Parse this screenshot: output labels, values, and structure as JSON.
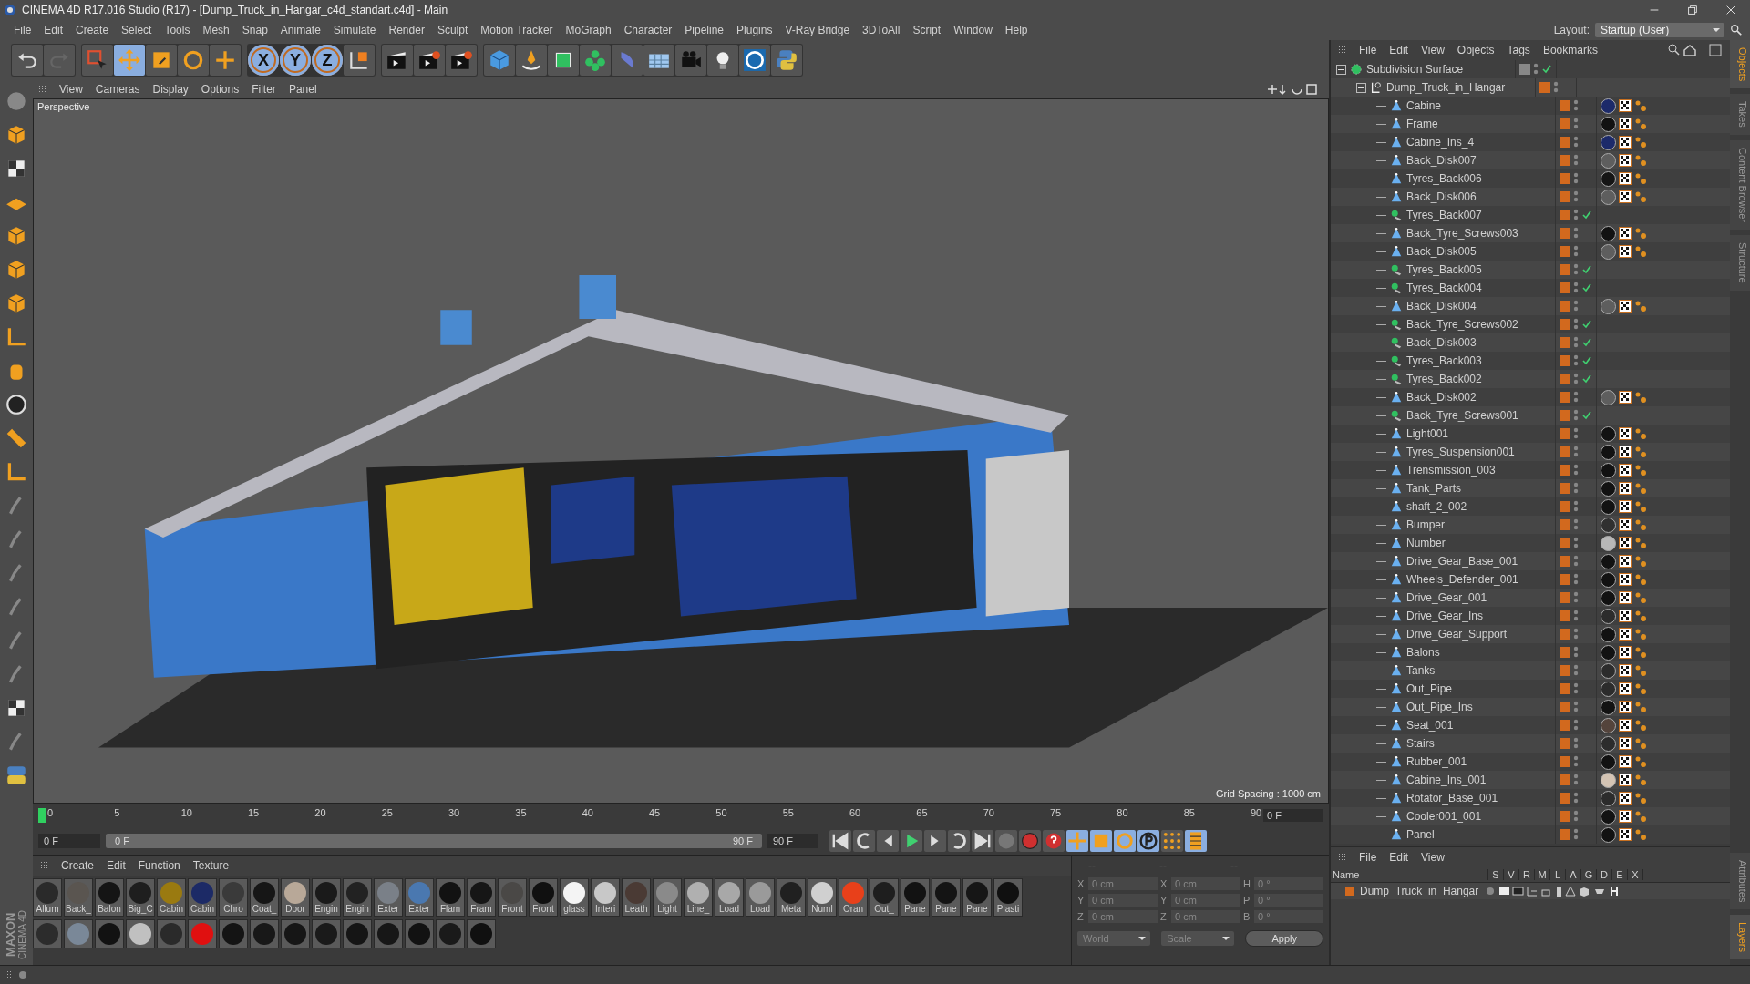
{
  "window": {
    "title": "CINEMA 4D R17.016 Studio (R17) - [Dump_Truck_in_Hangar_c4d_standart.c4d] - Main"
  },
  "menu": [
    "File",
    "Edit",
    "Create",
    "Select",
    "Tools",
    "Mesh",
    "Snap",
    "Animate",
    "Simulate",
    "Render",
    "Sculpt",
    "Motion Tracker",
    "MoGraph",
    "Character",
    "Pipeline",
    "Plugins",
    "V-Ray Bridge",
    "3DToAll",
    "Script",
    "Window",
    "Help"
  ],
  "layout": {
    "label": "Layout:",
    "value": "Startup (User)"
  },
  "toolbar": {
    "move_selected": true,
    "axis_buttons": [
      {
        "label": "X",
        "selected": true
      },
      {
        "label": "Y",
        "selected": true
      },
      {
        "label": "Z",
        "selected": true
      }
    ]
  },
  "left_toolbar": {
    "logo": [
      "MAXON",
      "CINEMA 4D"
    ]
  },
  "viewport": {
    "menu": [
      "View",
      "Cameras",
      "Display",
      "Options",
      "Filter",
      "Panel"
    ],
    "camera": "Perspective",
    "grid_spacing": "Grid Spacing : 1000 cm"
  },
  "timeline": {
    "ticks": [
      "0",
      "5",
      "10",
      "15",
      "20",
      "25",
      "30",
      "35",
      "40",
      "45",
      "50",
      "55",
      "60",
      "65",
      "70",
      "75",
      "80",
      "85",
      "90"
    ],
    "current_frame": "0 F",
    "start_field": "0 F",
    "range": {
      "level": 1,
      "start": "0 F",
      "end": "90 F"
    },
    "end_field": "90 F"
  },
  "material_manager": {
    "menu": [
      "Create",
      "Edit",
      "Function",
      "Texture"
    ],
    "materials": [
      {
        "label": "Allum",
        "color": "#2a2a2a"
      },
      {
        "label": "Back_",
        "color": "#5a5550"
      },
      {
        "label": "Balon",
        "color": "#151515"
      },
      {
        "label": "Big_C",
        "color": "#1e1e1e"
      },
      {
        "label": "Cabin",
        "color": "#9a7a10"
      },
      {
        "label": "Cabin",
        "color": "#1c2a66"
      },
      {
        "label": "Chro",
        "color": "#3a3a3a"
      },
      {
        "label": "Coat_",
        "color": "#161616"
      },
      {
        "label": "Door",
        "color": "#b8a898"
      },
      {
        "label": "Engin",
        "color": "#1a1a1a"
      },
      {
        "label": "Engin",
        "color": "#222222"
      },
      {
        "label": "Exter",
        "color": "#7a8088"
      },
      {
        "label": "Exter",
        "color": "#4a78b0"
      },
      {
        "label": "Flam",
        "color": "#121212"
      },
      {
        "label": "Fram",
        "color": "#161616"
      },
      {
        "label": "Front",
        "color": "#4a4846"
      },
      {
        "label": "Front",
        "color": "#101010"
      },
      {
        "label": "glass",
        "color": "#f4f4f4"
      },
      {
        "label": "Interi",
        "color": "#c8c8c8"
      },
      {
        "label": "Leath",
        "color": "#4a3a34"
      },
      {
        "label": "Light",
        "color": "#8a8a8a"
      },
      {
        "label": "Line_",
        "color": "#b0b0b0"
      },
      {
        "label": "Load",
        "color": "#a8a8a8"
      },
      {
        "label": "Load",
        "color": "#9a9a9a"
      },
      {
        "label": "Meta",
        "color": "#202020"
      },
      {
        "label": "Numl",
        "color": "#d0d0d0"
      },
      {
        "label": "Oran",
        "color": "#e8401a"
      },
      {
        "label": "Out_",
        "color": "#1e1e1e"
      },
      {
        "label": "Pane",
        "color": "#121212"
      },
      {
        "label": "Pane",
        "color": "#141414"
      },
      {
        "label": "Pane",
        "color": "#161616"
      },
      {
        "label": "Plasti",
        "color": "#101010"
      }
    ],
    "materials_row_2": [
      {
        "color": "#2c2c2c"
      },
      {
        "color": "#7a8898"
      },
      {
        "color": "#121212"
      },
      {
        "color": "#c0c0c0"
      },
      {
        "color": "#2a2a2a"
      },
      {
        "color": "#e01010"
      },
      {
        "color": "#141414"
      },
      {
        "color": "#181818"
      },
      {
        "color": "#161616"
      },
      {
        "color": "#1a1a1a"
      },
      {
        "color": "#151515"
      },
      {
        "color": "#171717"
      },
      {
        "color": "#121212"
      },
      {
        "color": "#1a1a1a"
      },
      {
        "color": "#101010"
      }
    ]
  },
  "coordinates": {
    "headers": [
      "--",
      "--",
      "--"
    ],
    "rows": [
      {
        "axis": "X",
        "position": "0 cm",
        "axis_2": "X",
        "size": "0 cm",
        "rot_axis": "H",
        "rotation": "0 °"
      },
      {
        "axis": "Y",
        "position": "0 cm",
        "axis_2": "Y",
        "size": "0 cm",
        "rot_axis": "P",
        "rotation": "0 °"
      },
      {
        "axis": "Z",
        "position": "0 cm",
        "axis_2": "Z",
        "size": "0 cm",
        "rot_axis": "B",
        "rotation": "0 °"
      }
    ],
    "space": "World",
    "mode": "Scale",
    "apply": "Apply"
  },
  "object_manager": {
    "menu": [
      "File",
      "Edit",
      "View",
      "Objects",
      "Tags",
      "Bookmarks"
    ],
    "objects": [
      {
        "name": "Subdivision Surface",
        "kind": "subdivision",
        "checked": true,
        "expanded": true,
        "children": [
          {
            "name": "Dump_Truck_in_Hangar",
            "kind": "null",
            "checked": false,
            "expanded": true,
            "children": [
              {
                "name": "Cabine",
                "kind": "polygon",
                "checked": false,
                "color": "#1c2a6a"
              },
              {
                "name": "Frame",
                "kind": "polygon",
                "checked": false,
                "color": "#121212"
              },
              {
                "name": "Cabine_Ins_4",
                "kind": "polygon",
                "checked": false,
                "color": "#1c2a6a"
              },
              {
                "name": "Back_Disk007",
                "kind": "polygon",
                "checked": false,
                "color": "#5e5e5e"
              },
              {
                "name": "Tyres_Back006",
                "kind": "polygon",
                "checked": false,
                "color": "#151515"
              },
              {
                "name": "Back_Disk006",
                "kind": "polygon",
                "checked": false,
                "color": "#5e5e5e"
              },
              {
                "name": "Tyres_Back007",
                "kind": "instance",
                "checked": true
              },
              {
                "name": "Back_Tyre_Screws003",
                "kind": "polygon",
                "checked": false,
                "color": "#121212"
              },
              {
                "name": "Back_Disk005",
                "kind": "polygon",
                "checked": false,
                "color": "#5e5e5e"
              },
              {
                "name": "Tyres_Back005",
                "kind": "instance",
                "checked": true
              },
              {
                "name": "Tyres_Back004",
                "kind": "instance",
                "checked": true
              },
              {
                "name": "Back_Disk004",
                "kind": "polygon",
                "checked": false,
                "color": "#5e5e5e"
              },
              {
                "name": "Back_Tyre_Screws002",
                "kind": "instance",
                "checked": true
              },
              {
                "name": "Back_Disk003",
                "kind": "instance",
                "checked": true
              },
              {
                "name": "Tyres_Back003",
                "kind": "instance",
                "checked": true
              },
              {
                "name": "Tyres_Back002",
                "kind": "instance",
                "checked": true
              },
              {
                "name": "Back_Disk002",
                "kind": "polygon",
                "checked": false,
                "color": "#5e5e5e"
              },
              {
                "name": "Back_Tyre_Screws001",
                "kind": "instance",
                "checked": true
              },
              {
                "name": "Light001",
                "kind": "polygon",
                "checked": false,
                "color": "#121212"
              },
              {
                "name": "Tyres_Suspension001",
                "kind": "polygon",
                "checked": false,
                "color": "#121212"
              },
              {
                "name": "Trensmission_003",
                "kind": "polygon",
                "checked": false,
                "color": "#121212"
              },
              {
                "name": "Tank_Parts",
                "kind": "polygon",
                "checked": false,
                "color": "#121212"
              },
              {
                "name": "shaft_2_002",
                "kind": "polygon",
                "checked": false,
                "color": "#121212"
              },
              {
                "name": "Bumper",
                "kind": "polygon",
                "checked": false,
                "color": "#303030"
              },
              {
                "name": "Number",
                "kind": "polygon",
                "checked": false,
                "color": "#b8b8b8"
              },
              {
                "name": "Drive_Gear_Base_001",
                "kind": "polygon",
                "checked": false,
                "color": "#121212"
              },
              {
                "name": "Wheels_Defender_001",
                "kind": "polygon",
                "checked": false,
                "color": "#121212"
              },
              {
                "name": "Drive_Gear_001",
                "kind": "polygon",
                "checked": false,
                "color": "#121212"
              },
              {
                "name": "Drive_Gear_Ins",
                "kind": "polygon",
                "checked": false,
                "color": "#2c2c2c"
              },
              {
                "name": "Drive_Gear_Support",
                "kind": "polygon",
                "checked": false,
                "color": "#121212"
              },
              {
                "name": "Balons",
                "kind": "polygon",
                "checked": false,
                "color": "#121212"
              },
              {
                "name": "Tanks",
                "kind": "polygon",
                "checked": false,
                "color": "#2c2c2c"
              },
              {
                "name": "Out_Pipe",
                "kind": "polygon",
                "checked": false,
                "color": "#2c2c2c"
              },
              {
                "name": "Out_Pipe_Ins",
                "kind": "polygon",
                "checked": false,
                "color": "#121212"
              },
              {
                "name": "Seat_001",
                "kind": "polygon",
                "checked": false,
                "color": "#54443c"
              },
              {
                "name": "Stairs",
                "kind": "polygon",
                "checked": false,
                "color": "#2c2c2c"
              },
              {
                "name": "Rubber_001",
                "kind": "polygon",
                "checked": false,
                "color": "#121212"
              },
              {
                "name": "Cabine_Ins_001",
                "kind": "polygon",
                "checked": false,
                "color": "#d4c4b4"
              },
              {
                "name": "Rotator_Base_001",
                "kind": "polygon",
                "checked": false,
                "color": "#2c2c2c"
              },
              {
                "name": "Cooler001_001",
                "kind": "polygon",
                "checked": false,
                "color": "#121212"
              },
              {
                "name": "Panel",
                "kind": "polygon",
                "checked": false,
                "color": "#121212"
              }
            ]
          }
        ]
      }
    ]
  },
  "side_tabs": [
    {
      "label": "Objects",
      "selected": true
    },
    {
      "label": "Takes",
      "selected": false
    },
    {
      "label": "Content Browser",
      "selected": false
    },
    {
      "label": "Structure",
      "selected": false
    }
  ],
  "layer_manager": {
    "menu": [
      "File",
      "Edit",
      "View"
    ],
    "columns": [
      "Name",
      "S",
      "V",
      "R",
      "M",
      "L",
      "A",
      "G",
      "D",
      "E",
      "X"
    ],
    "layers": [
      {
        "name": "Dump_Truck_in_Hangar",
        "color": "#d2691e"
      }
    ]
  },
  "side_tabs_bottom": [
    {
      "label": "Attributes",
      "selected": false
    },
    {
      "label": "Layers",
      "selected": true
    }
  ]
}
